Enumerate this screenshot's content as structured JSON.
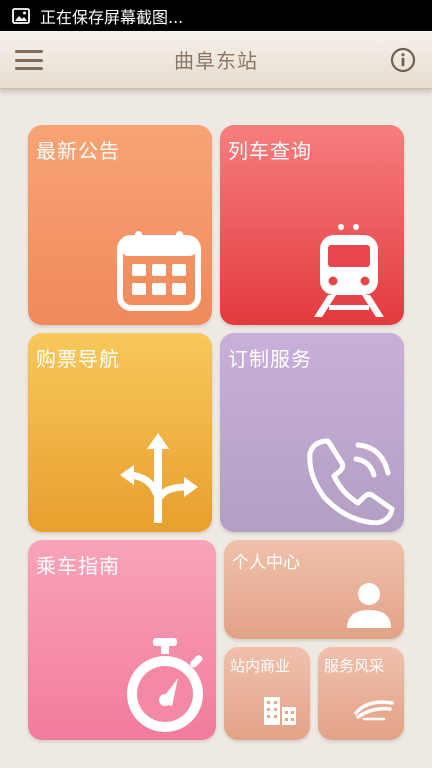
{
  "status_bar": {
    "text": "正在保存屏幕截图...",
    "icon": "image-icon"
  },
  "header": {
    "title": "曲阜东站",
    "menu_icon": "hamburger-menu-icon",
    "info_icon": "info-icon"
  },
  "tiles": {
    "notice": {
      "label": "最新公告",
      "icon": "calendar-icon"
    },
    "train": {
      "label": "列车查询",
      "icon": "train-icon"
    },
    "ticket": {
      "label": "购票导航",
      "icon": "direction-arrows-icon"
    },
    "order": {
      "label": "订制服务",
      "icon": "phone-icon"
    },
    "guide": {
      "label": "乘车指南",
      "icon": "stopwatch-icon"
    },
    "personal": {
      "label": "个人中心",
      "icon": "user-icon"
    },
    "shop": {
      "label": "站内商业",
      "icon": "buildings-icon"
    },
    "style": {
      "label": "服务风采",
      "icon": "railway-logo-icon"
    }
  },
  "colors": {
    "background": "#efe9e3",
    "notice": "#f39061",
    "train": "#ea4a4d",
    "ticket": "#f0b040",
    "order": "#bca6cc",
    "guide": "#f58aa6",
    "personal": "#e8ae95"
  }
}
